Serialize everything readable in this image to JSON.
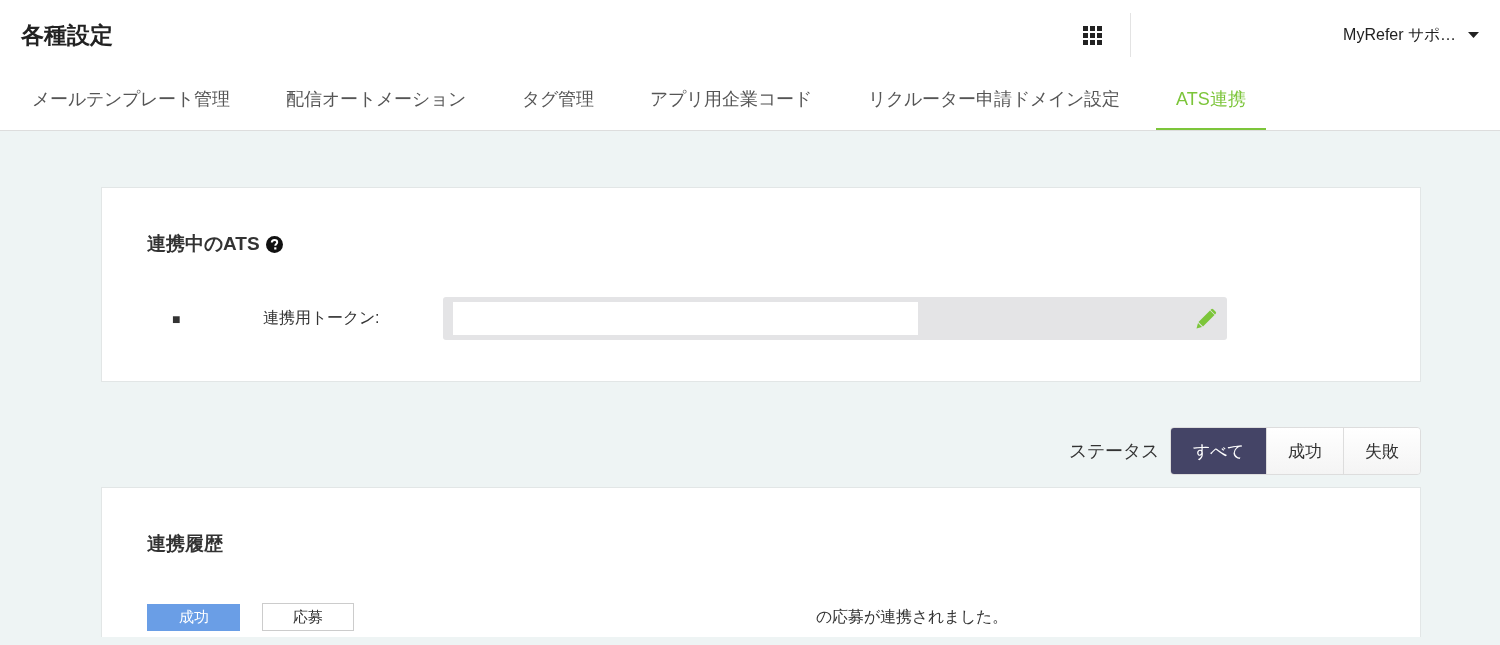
{
  "header": {
    "title": "各種設定",
    "user_menu": "MyRefer サポ…"
  },
  "tabs": [
    {
      "label": "メールテンプレート管理",
      "selected": false
    },
    {
      "label": "配信オートメーション",
      "selected": false
    },
    {
      "label": "タグ管理",
      "selected": false
    },
    {
      "label": "アプリ用企業コード",
      "selected": false
    },
    {
      "label": "リクルーター申請ドメイン設定",
      "selected": false
    },
    {
      "label": "ATS連携",
      "selected": true
    }
  ],
  "ats_card": {
    "title": "連携中のATS",
    "bullet": "■",
    "token_label": "連携用トークン:"
  },
  "status_filter": {
    "label": "ステータス",
    "options": [
      {
        "label": "すべて",
        "selected": true
      },
      {
        "label": "成功",
        "selected": false
      },
      {
        "label": "失敗",
        "selected": false
      }
    ]
  },
  "history": {
    "title": "連携履歴",
    "rows": [
      {
        "status": "成功",
        "kind": "success",
        "type": "応募",
        "message": "の応募が連携されました。"
      }
    ]
  }
}
